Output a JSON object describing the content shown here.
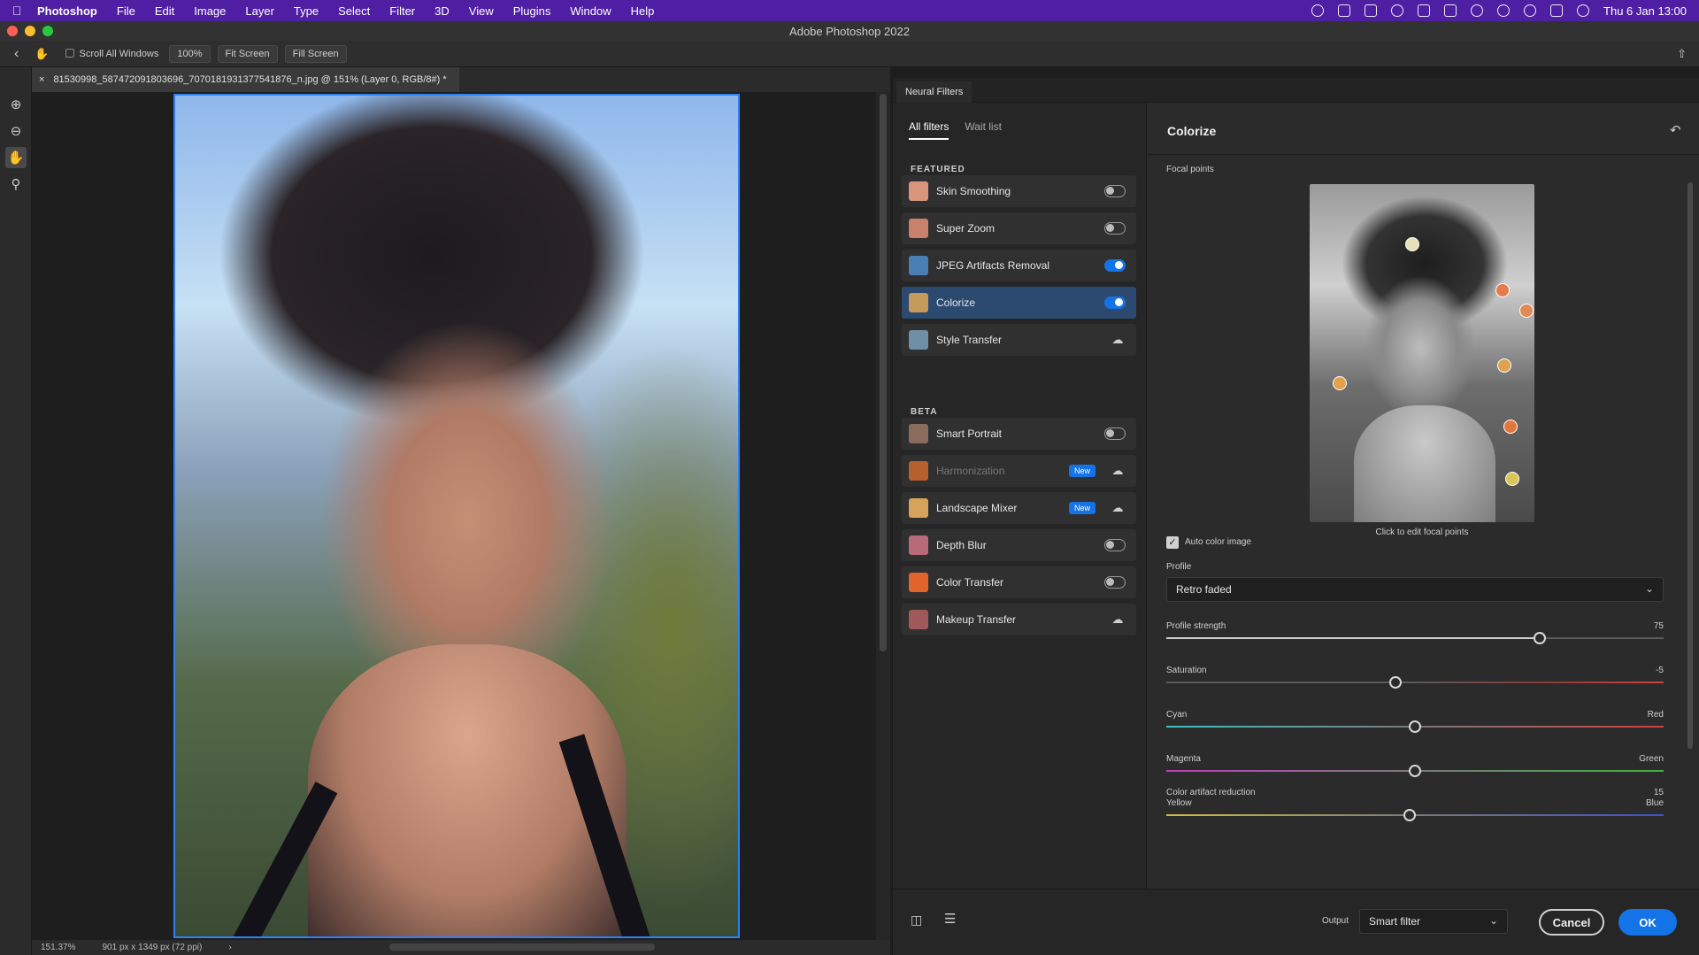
{
  "menubar": {
    "app": "Photoshop",
    "items": [
      "File",
      "Edit",
      "Image",
      "Layer",
      "Type",
      "Select",
      "Filter",
      "3D",
      "View",
      "Plugins",
      "Window",
      "Help"
    ],
    "clock": "Thu 6 Jan  13:00"
  },
  "window": {
    "title": "Adobe Photoshop 2022"
  },
  "options": {
    "scroll_all_windows": "Scroll All Windows",
    "zoom_100": "100%",
    "fit_screen": "Fit Screen",
    "fill_screen": "Fill Screen"
  },
  "document": {
    "tab_title": "81530998_587472091803696_7070181931377541876_n.jpg @ 151% (Layer 0, RGB/8#) *",
    "zoom": "151.37%",
    "dimensions": "901 px x 1349 px (72 ppi)"
  },
  "neural": {
    "panel_title": "Neural Filters",
    "tabs": [
      "All filters",
      "Wait list"
    ],
    "featured_label": "FEATURED",
    "beta_label": "BETA",
    "featured": [
      {
        "label": "Skin Smoothing",
        "control": "toggle",
        "on": false,
        "color": "#d8957c"
      },
      {
        "label": "Super Zoom",
        "control": "toggle",
        "on": false,
        "color": "#c9806c"
      },
      {
        "label": "JPEG Artifacts Removal",
        "control": "toggle",
        "on": true,
        "color": "#4a7fb5"
      },
      {
        "label": "Colorize",
        "control": "toggle",
        "on": true,
        "color": "#c49b5a"
      },
      {
        "label": "Style Transfer",
        "control": "cloud",
        "color": "#6f8fa6"
      }
    ],
    "beta": [
      {
        "label": "Smart Portrait",
        "control": "toggle",
        "on": false,
        "color": "#8a6c5c"
      },
      {
        "label": "Harmonization",
        "control": "cloud",
        "badge": "New",
        "dim": true,
        "color": "#b7602f"
      },
      {
        "label": "Landscape Mixer",
        "control": "cloud",
        "badge": "New",
        "color": "#d6a35a"
      },
      {
        "label": "Depth Blur",
        "control": "toggle",
        "on": false,
        "color": "#b76a78"
      },
      {
        "label": "Color Transfer",
        "control": "toggle",
        "on": false,
        "color": "#e0642b"
      },
      {
        "label": "Makeup Transfer",
        "control": "cloud",
        "color": "#a0595a"
      }
    ]
  },
  "colorize": {
    "title": "Colorize",
    "focal_points_label": "Focal points",
    "focal_caption": "Click to edit focal points",
    "auto_color_label": "Auto color image",
    "profile_label": "Profile",
    "profile_value": "Retro faded",
    "sliders": [
      {
        "label": "Profile strength",
        "value": "75",
        "pos": 0.75
      },
      {
        "label": "Saturation",
        "value": "-5",
        "pos": 0.46
      },
      {
        "label": "Cyan",
        "right_label": "Red",
        "pos": 0.5
      },
      {
        "label": "Magenta",
        "right_label": "Green",
        "pos": 0.5
      },
      {
        "label": "Yellow",
        "right_label": "Blue",
        "pos": 0.49
      }
    ],
    "artifact_label": "Color artifact reduction",
    "artifact_value": "15",
    "focal_dot_colors": [
      "#e6e0b8",
      "#e57a4e",
      "#e08a55",
      "#e0a24e",
      "#e0a24e",
      "#e0773f",
      "#d9c65a"
    ]
  },
  "footer": {
    "output_label": "Output",
    "output_value": "Smart filter",
    "cancel": "Cancel",
    "ok": "OK"
  }
}
